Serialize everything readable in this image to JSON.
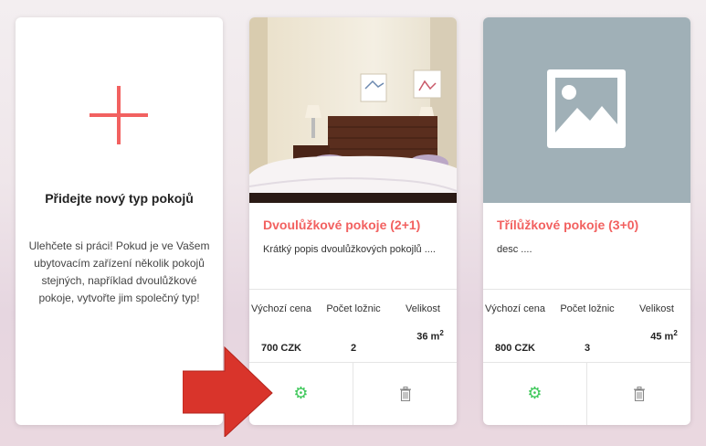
{
  "add_card": {
    "title": "Přidejte nový typ pokojů",
    "text": "Ulehčete si práci! Pokud je ve Vašem ubytovacím zařízení několik pokojů stejných, například dvoulůžkové pokoje, vytvořte jim společný typ!"
  },
  "stat_labels": {
    "price": "Výchozí cena",
    "bedrooms": "Počet ložnic",
    "size": "Velikost"
  },
  "rooms": [
    {
      "title": "Dvoulůžkové pokoje (2+1)",
      "desc": "Krátký popis dvoulůžkových pokojlů ....",
      "price": "700 CZK",
      "bedrooms": "2",
      "size": "36 m",
      "size_unit_sup": "2"
    },
    {
      "title": "Třílůžkové pokoje (3+0)",
      "desc": "desc ....",
      "price": "800 CZK",
      "bedrooms": "3",
      "size": "45 m",
      "size_unit_sup": "2"
    }
  ],
  "icons": {
    "add": "plus-icon",
    "edit": "gear-icon",
    "delete": "trash-icon",
    "placeholder": "image-placeholder-icon"
  },
  "colors": {
    "accent": "#f26160",
    "edit": "#3ec85a",
    "placeholder_bg": "#a0b0b7"
  }
}
